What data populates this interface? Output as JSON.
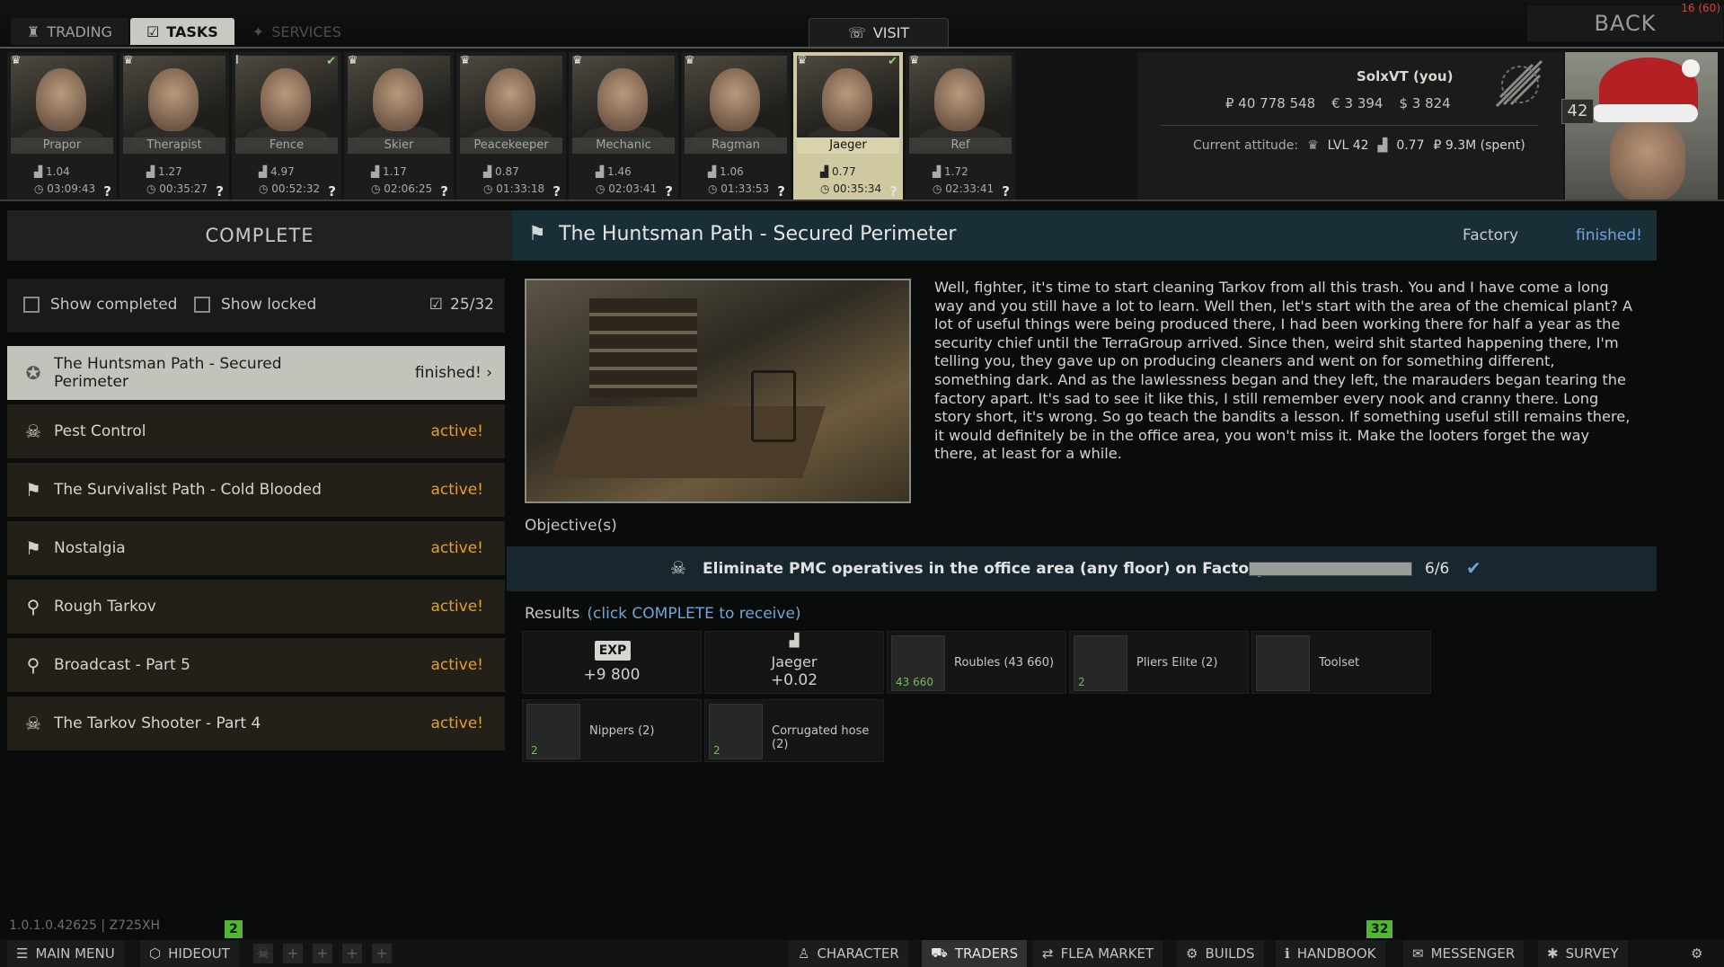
{
  "topbar": {
    "tabs": [
      {
        "label": "TRADING",
        "icon": "trading-icon"
      },
      {
        "label": "TASKS",
        "icon": "tasks-icon"
      },
      {
        "label": "SERVICES",
        "icon": "services-icon"
      }
    ],
    "visit_label": "VISIT",
    "back_label": "BACK",
    "fps": "16 (60)"
  },
  "traders": [
    {
      "name": "Prapor",
      "rank": "♛",
      "stat": "1.04",
      "time": "03:09:43",
      "question": "?"
    },
    {
      "name": "Therapist",
      "rank": "♛",
      "stat": "1.27",
      "time": "00:35:27",
      "question": "?"
    },
    {
      "name": "Fence",
      "rank": "I",
      "stat": "4.97",
      "time": "00:52:32",
      "question": "?",
      "check": true
    },
    {
      "name": "Skier",
      "rank": "♛",
      "stat": "1.17",
      "time": "02:06:25",
      "question": "?"
    },
    {
      "name": "Peacekeeper",
      "rank": "♛",
      "stat": "0.87",
      "time": "01:33:18",
      "question": "?"
    },
    {
      "name": "Mechanic",
      "rank": "♛",
      "stat": "1.46",
      "time": "02:03:41",
      "question": "?"
    },
    {
      "name": "Ragman",
      "rank": "♛",
      "stat": "1.06",
      "time": "01:33:53",
      "question": "?"
    },
    {
      "name": "Jaeger",
      "rank": "♛",
      "stat": "0.77",
      "time": "00:35:34",
      "question": "?",
      "check": true,
      "selected": true
    },
    {
      "name": "Ref",
      "rank": "♛",
      "stat": "1.72",
      "time": "02:33:41",
      "question": "?"
    }
  ],
  "player": {
    "name": "SolxVT (you)",
    "roubles": "₽ 40 778 548",
    "euros": "€ 3 394",
    "dollars": "$ 3 824",
    "attitude_label": "Current attitude:",
    "lvl": "LVL 42",
    "standing": "0.77",
    "spent": "₽ 9.3M (spent)",
    "level_badge": "42"
  },
  "left": {
    "complete_label": "COMPLETE",
    "show_completed": "Show completed",
    "show_locked": "Show locked",
    "count": "25/32",
    "quests": [
      {
        "title": "The Huntsman Path - Secured Perimeter",
        "status": "finished!",
        "icon": "✪",
        "selected": true
      },
      {
        "title": "Pest Control",
        "status": "active!",
        "icon": "☠"
      },
      {
        "title": "The Survivalist Path - Cold Blooded",
        "status": "active!",
        "icon": "⚑"
      },
      {
        "title": "Nostalgia",
        "status": "active!",
        "icon": "⚑"
      },
      {
        "title": "Rough Tarkov",
        "status": "active!",
        "icon": "⚲"
      },
      {
        "title": "Broadcast - Part 5",
        "status": "active!",
        "icon": "⚲"
      },
      {
        "title": "The Tarkov Shooter - Part 4",
        "status": "active!",
        "icon": "☠"
      }
    ]
  },
  "quest": {
    "title": "The Huntsman Path - Secured Perimeter",
    "location": "Factory",
    "status": "finished!",
    "description": "Well, fighter, it's time to start cleaning Tarkov from all this trash. You and I have come a long way and you still have a lot to learn. Well then, let's start with the area of the chemical plant? A lot of useful things were being produced there, I had been working there for half a year as the security chief until the TerraGroup arrived. Since then, weird shit started happening there, I'm telling you, they gave up on producing cleaners and went on for something different, something dark. And as the lawlessness began and they left, the marauders began tearing the factory apart. It's sad to see it like this, I still remember every nook and cranny there. Long story short, it's wrong. So go teach the bandits a lesson. If something useful still remains there, it would definitely be in the office area, you won't miss it. Make the looters forget the way there, at least for a while.",
    "objectives_label": "Objective(s)",
    "objective": {
      "text": "Eliminate PMC operatives in the office area (any floor) on Factory",
      "count": "6/6",
      "progress": 1.0
    },
    "results_label": "Results",
    "results_hint": "(click COMPLETE to receive)",
    "rewards": {
      "exp_badge": "EXP",
      "exp_value": "+9 800",
      "rep_name": "Jaeger",
      "rep_value": "+0.02",
      "items": [
        {
          "name": "Roubles (43 660)",
          "qty": "43 660"
        },
        {
          "name": "Pliers Elite (2)",
          "qty": "2"
        },
        {
          "name": "Toolset",
          "qty": ""
        },
        {
          "name": "Nippers (2)",
          "qty": "2"
        },
        {
          "name": "Corrugated hose (2)",
          "qty": "2"
        }
      ]
    }
  },
  "bottom": {
    "version": "1.0.1.0.42625 | Z725XH",
    "hideout_badge": "2",
    "handbook_badge": "32",
    "buttons": [
      "MAIN MENU",
      "HIDEOUT",
      "CHARACTER",
      "TRADERS",
      "FLEA MARKET",
      "BUILDS",
      "HANDBOOK",
      "MESSENGER",
      "SURVEY"
    ]
  }
}
